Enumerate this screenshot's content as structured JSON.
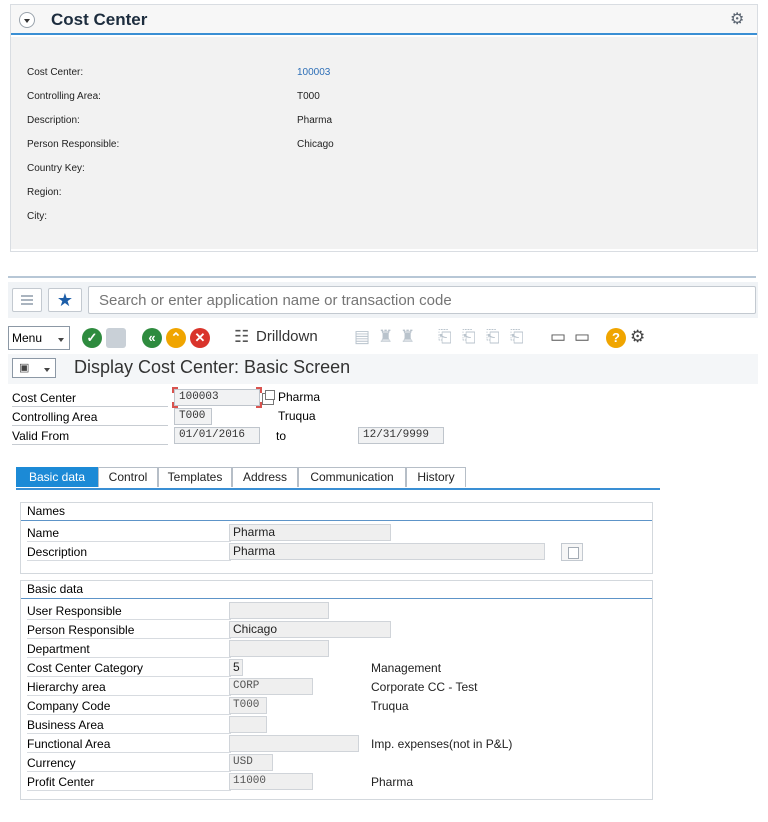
{
  "card": {
    "title": "Cost Center",
    "rows": [
      {
        "label": "Cost Center:",
        "value": "100003"
      },
      {
        "label": "Controlling Area:",
        "value": "T000"
      },
      {
        "label": "Description:",
        "value": "Pharma"
      },
      {
        "label": "Person Responsible:",
        "value": "Chicago"
      },
      {
        "label": "Country Key:",
        "value": ""
      },
      {
        "label": "Region:",
        "value": ""
      },
      {
        "label": "City:",
        "value": ""
      }
    ]
  },
  "search": {
    "placeholder": "Search or enter application name or transaction code"
  },
  "toolbar": {
    "menu_label": "Menu",
    "drilldown_label": "Drilldown"
  },
  "page": {
    "title": "Display Cost Center: Basic Screen"
  },
  "header": {
    "cost_center": {
      "label": "Cost Center",
      "value": "100003",
      "text": "Pharma"
    },
    "controlling_area": {
      "label": "Controlling Area",
      "value": "T000",
      "text": "Truqua"
    },
    "valid_from": {
      "label": "Valid From",
      "from": "01/01/2016",
      "to_label": "to",
      "to": "12/31/9999"
    }
  },
  "tabs": [
    "Basic data",
    "Control",
    "Templates",
    "Address",
    "Communication",
    "History"
  ],
  "names_group": {
    "title": "Names",
    "rows": [
      {
        "label": "Name",
        "value": "Pharma"
      },
      {
        "label": "Description",
        "value": "Pharma"
      }
    ]
  },
  "basic_group": {
    "title": "Basic data",
    "rows": [
      {
        "label": "User Responsible",
        "value": "",
        "desc": ""
      },
      {
        "label": "Person Responsible",
        "value": "Chicago",
        "desc": ""
      },
      {
        "label": "Department",
        "value": "",
        "desc": ""
      },
      {
        "label": "Cost Center Category",
        "value": "5",
        "desc": "Management"
      },
      {
        "label": "Hierarchy area",
        "value": "CORP",
        "desc": "Corporate CC - Test"
      },
      {
        "label": "Company Code",
        "value": "T000",
        "desc": "Truqua"
      },
      {
        "label": "Business Area",
        "value": "",
        "desc": ""
      },
      {
        "label": "Functional Area",
        "value": "",
        "desc": "Imp. expenses(not in P&L)"
      },
      {
        "label": "Currency",
        "value": "USD",
        "desc": ""
      },
      {
        "label": "Profit Center",
        "value": "11000",
        "desc": "Pharma"
      }
    ]
  },
  "colors": {
    "accent": "#1c8ad6",
    "link": "#2e6fb7",
    "ok": "#2e8b3e",
    "nav": "#f0a500",
    "cancel": "#d9342b"
  }
}
